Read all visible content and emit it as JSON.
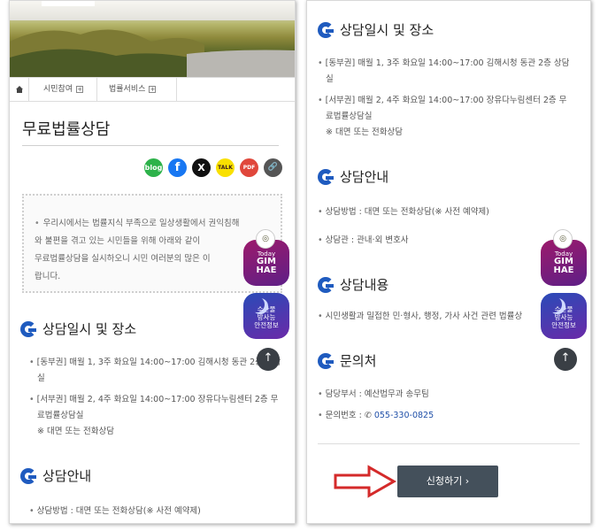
{
  "nav": {
    "items": [
      {
        "label": "시민참여",
        "icon": "plus-icon"
      },
      {
        "label": "법률서비스",
        "icon": "plus-icon"
      }
    ]
  },
  "page_title": "무료법률상담",
  "share": {
    "blog_label": "blog",
    "facebook_label": "f",
    "x_label": "X",
    "talk_label": "TALK",
    "pdf_label": "PDF",
    "link_label": "🔗"
  },
  "intro": {
    "line1": "우리시에서는 법률지식 부족으로 일상생활에서 권익침해",
    "line2": "와 불편을 겪고 있는 시민들을 위해 아래와 같이",
    "line3": "무료법률상담을 실시하오니 시민 여러분의 많은 이",
    "line4": "랍니다."
  },
  "sections": {
    "schedule": {
      "title": "상담일시 및 장소",
      "east_1": "[동부권] 매월 1, 3주 화요일 14:00~17:00 김해시청 동관 2층 상담",
      "east_2": "실",
      "west_1": "[서부권] 매월 2, 4주 화요일 14:00~17:00 장유다누림센터 2층 무",
      "west_2": "료법률상담실",
      "note": "※ 대면 또는 전화상담"
    },
    "guide": {
      "title": "상담안내",
      "method": "상담방법 : 대면 또는 전화상담(※ 사전 예약제)",
      "counselor": "상담관 : 관내·외 변호사"
    },
    "content": {
      "title": "상담내용",
      "text": "시민생활과 밀접한 민·형사, 행정, 가사 사건 관련 법률상"
    },
    "contact": {
      "title": "문의처",
      "dept": "담당부서 : 예산법무과 송무팀",
      "phone_label": "문의번호 :",
      "phone": "055-330-0825"
    }
  },
  "floating": {
    "today_small": "Today",
    "today_big1": "GIM",
    "today_big2": "HAE",
    "safe_line1": "수산물",
    "safe_line2": "방사능",
    "safe_line3": "안전정보",
    "top_icon": "↑"
  },
  "apply_button": "신청하기  ›",
  "colors": {
    "brand_blue": "#1f5bbf",
    "button_dark": "#44505b",
    "arrow_red": "#d42a2a"
  }
}
